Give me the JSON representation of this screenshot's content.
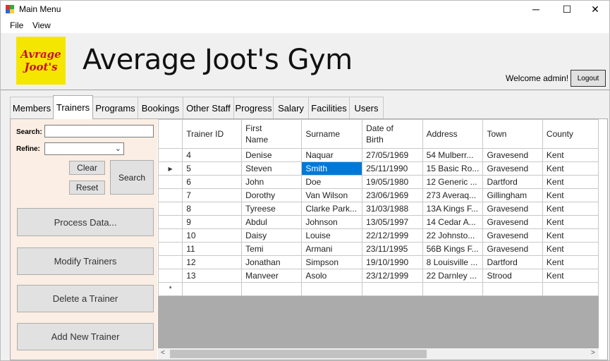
{
  "window": {
    "title": "Main Menu",
    "minimize": "─",
    "maximize": "☐",
    "close": "✕"
  },
  "menu": {
    "file": "File",
    "view": "View"
  },
  "header": {
    "logo_line1": "Avrage",
    "logo_line2": "Joot's",
    "app_title": "Average Joot's Gym",
    "welcome": "Welcome admin!",
    "logout": "Logout"
  },
  "tabs": [
    "Members",
    "Trainers",
    "Programs",
    "Bookings",
    "Other Staff",
    "Progress",
    "Salary",
    "Facilities",
    "Users"
  ],
  "active_tab": "Trainers",
  "filters": {
    "search_label": "Search:",
    "search_value": "",
    "refine_label": "Refine:",
    "refine_value": "",
    "clear": "Clear",
    "reset": "Reset",
    "search_button": "Search"
  },
  "actions": {
    "process": "Process Data...",
    "modify": "Modify Trainers",
    "delete": "Delete a Trainer",
    "add": "Add New Trainer"
  },
  "grid": {
    "columns": [
      "Trainer ID",
      "First\nName",
      "Surname",
      "Date of\nBirth",
      "Address",
      "Town",
      "County"
    ],
    "rows": [
      [
        "4",
        "Denise",
        "Naquar",
        "27/05/1969",
        "54 Mulberr...",
        "Gravesend",
        "Kent"
      ],
      [
        "5",
        "Steven",
        "Smith",
        "25/11/1990",
        "15 Basic Ro...",
        "Gravesend",
        "Kent"
      ],
      [
        "6",
        "John",
        "Doe",
        "19/05/1980",
        "12 Generic ...",
        "Dartford",
        "Kent"
      ],
      [
        "7",
        "Dorothy",
        "Van Wilson",
        "23/06/1969",
        "273 Averaq...",
        "Gillingham",
        "Kent"
      ],
      [
        "8",
        "Tyreese",
        "Clarke Park...",
        "31/03/1988",
        "13A Kings F...",
        "Gravesend",
        "Kent"
      ],
      [
        "9",
        "Abdul",
        "Johnson",
        "13/05/1997",
        "14 Cedar A...",
        "Gravesend",
        "Kent"
      ],
      [
        "10",
        "Daisy",
        "Louise",
        "22/12/1999",
        "22 Johnsto...",
        "Gravesend",
        "Kent"
      ],
      [
        "11",
        "Temi",
        "Armani",
        "23/11/1995",
        "56B Kings F...",
        "Gravesend",
        "Kent"
      ],
      [
        "12",
        "Jonathan",
        "Simpson",
        "19/10/1990",
        "8 Louisville ...",
        "Dartford",
        "Kent"
      ],
      [
        "13",
        "Manveer",
        "Asolo",
        "23/12/1999",
        "22 Darnley ...",
        "Strood",
        "Kent"
      ]
    ],
    "current_row_index": 1,
    "selected_cell": [
      1,
      2
    ],
    "current_row_glyph": "▶",
    "new_row_glyph": "*"
  },
  "scrollbar": {
    "left": "<",
    "right": ">"
  }
}
